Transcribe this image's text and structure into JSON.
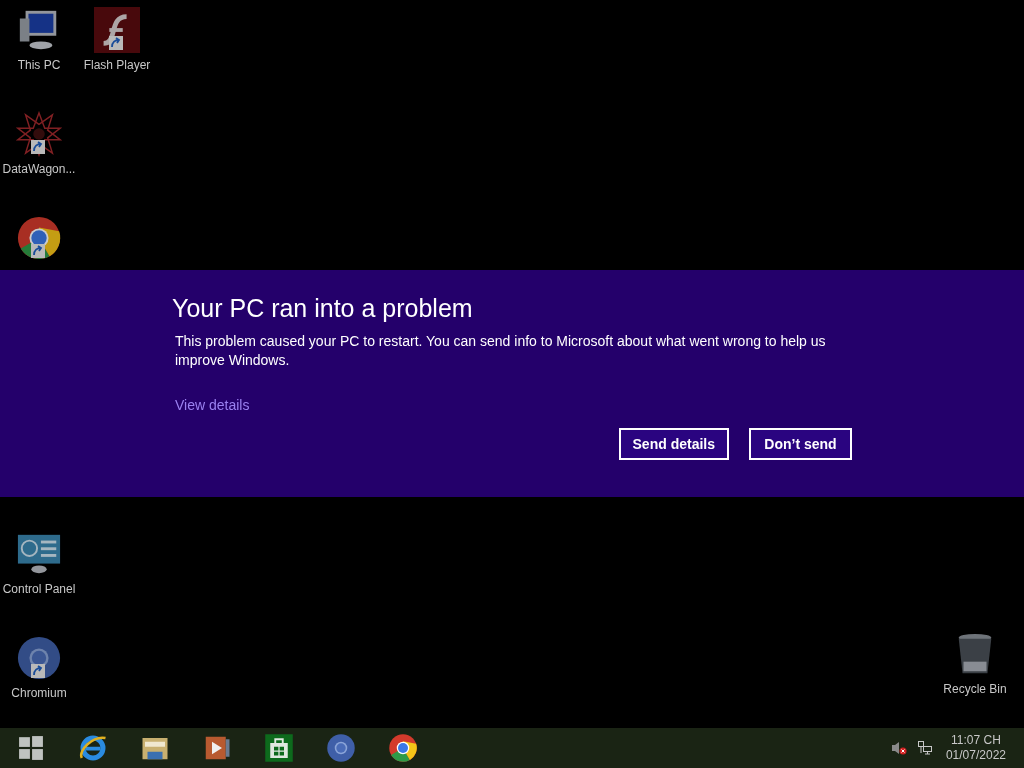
{
  "desktop_icons": [
    {
      "kind": "computer",
      "label": "This PC",
      "shortcut": false
    },
    {
      "kind": "flash",
      "label": "Flash Player",
      "shortcut": true
    },
    {
      "kind": "star",
      "label": "DataWagon...",
      "shortcut": true
    },
    {
      "kind": "chrome",
      "shortcut": true
    },
    {
      "kind": "control-panel",
      "label": "Control Panel",
      "shortcut": false
    },
    {
      "kind": "chromium",
      "label": "Chromium",
      "shortcut": true
    },
    {
      "kind": "recycle-bin",
      "label": "Recycle Bin",
      "shortcut": false
    }
  ],
  "error_banner": {
    "title": "Your PC ran into a problem",
    "message": "This problem caused your PC to restart. You can send info to Microsoft about what went wrong to help us improve Windows.",
    "link": "View details",
    "buttons": [
      "Send details",
      "Don’t send"
    ]
  },
  "taskbar": {
    "apps": [
      {
        "kind": "start"
      },
      {
        "kind": "ie"
      },
      {
        "kind": "explorer"
      },
      {
        "kind": "media"
      },
      {
        "kind": "store"
      },
      {
        "kind": "chromium"
      },
      {
        "kind": "chrome"
      }
    ],
    "tray": [
      {
        "kind": "volume-muted"
      },
      {
        "kind": "network"
      }
    ],
    "time": "11:07 CH",
    "date": "01/07/2022"
  }
}
